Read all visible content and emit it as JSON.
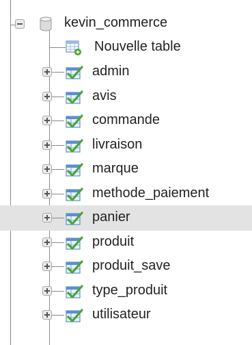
{
  "tree": {
    "database": {
      "name": "kevin_commerce",
      "icon": "database-icon",
      "expander": "collapse"
    },
    "new_table": {
      "label": "Nouvelle table",
      "icon": "new-table-icon"
    },
    "tables": [
      {
        "name": "admin",
        "icon": "table-icon",
        "expander": "expand"
      },
      {
        "name": "avis",
        "icon": "table-icon",
        "expander": "expand"
      },
      {
        "name": "commande",
        "icon": "table-icon",
        "expander": "expand"
      },
      {
        "name": "livraison",
        "icon": "table-icon",
        "expander": "expand"
      },
      {
        "name": "marque",
        "icon": "table-icon",
        "expander": "expand"
      },
      {
        "name": "methode_paiement",
        "icon": "table-icon",
        "expander": "expand"
      },
      {
        "name": "panier",
        "icon": "table-icon",
        "expander": "expand",
        "highlighted": true
      },
      {
        "name": "produit",
        "icon": "table-icon",
        "expander": "expand"
      },
      {
        "name": "produit_save",
        "icon": "table-icon",
        "expander": "expand"
      },
      {
        "name": "type_produit",
        "icon": "table-icon",
        "expander": "expand"
      },
      {
        "name": "utilisateur",
        "icon": "table-icon",
        "expander": "expand"
      }
    ]
  },
  "colors": {
    "hover_background": "#e3e3e3",
    "tree_line": "#8a8a8a",
    "table_icon_green": "#4aa52e",
    "table_icon_blue": "#5b8fd0"
  }
}
